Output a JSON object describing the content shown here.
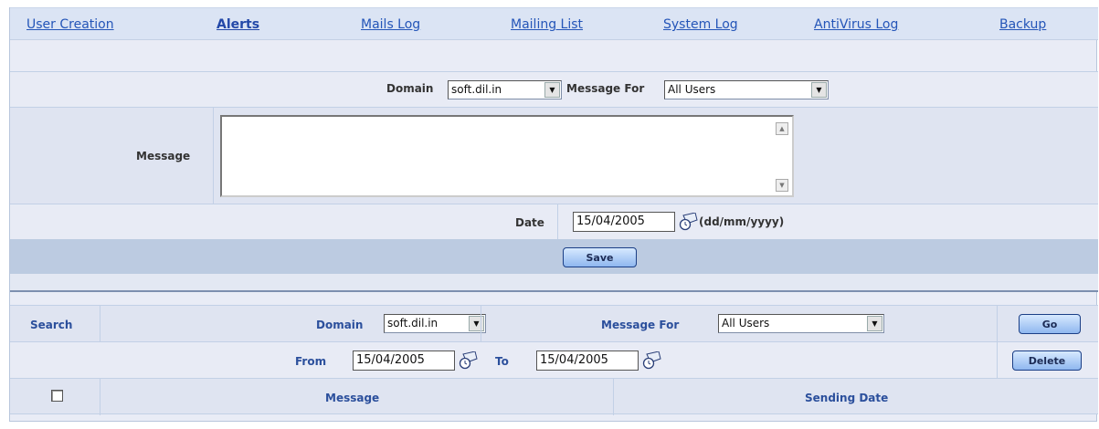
{
  "nav": {
    "items": [
      {
        "label": "User Creation",
        "active": false
      },
      {
        "label": "Alerts",
        "active": true
      },
      {
        "label": "Mails Log",
        "active": false
      },
      {
        "label": "Mailing List",
        "active": false
      },
      {
        "label": "System Log",
        "active": false
      },
      {
        "label": "AntiVirus Log",
        "active": false
      },
      {
        "label": "Backup",
        "active": false
      }
    ]
  },
  "form": {
    "domain_label": "Domain",
    "domain_value": "soft.dil.in",
    "message_for_label": "Message For",
    "message_for_value": "All Users",
    "message_label": "Message",
    "message_value": "",
    "date_label": "Date",
    "date_value": "15/04/2005",
    "date_format": "(dd/mm/yyyy)",
    "save_label": "Save"
  },
  "search": {
    "search_label": "Search",
    "domain_label": "Domain",
    "domain_value": "soft.dil.in",
    "message_for_label": "Message For",
    "message_for_value": "All Users",
    "go_label": "Go",
    "from_label": "From",
    "from_value": "15/04/2005",
    "to_label": "To",
    "to_value": "15/04/2005",
    "delete_label": "Delete"
  },
  "table": {
    "columns": [
      "Message",
      "Sending Date"
    ],
    "select_all_checked": false
  },
  "colors": {
    "link": "#2455b8",
    "button_border": "#1b3f86",
    "band": "#bccbe1"
  }
}
